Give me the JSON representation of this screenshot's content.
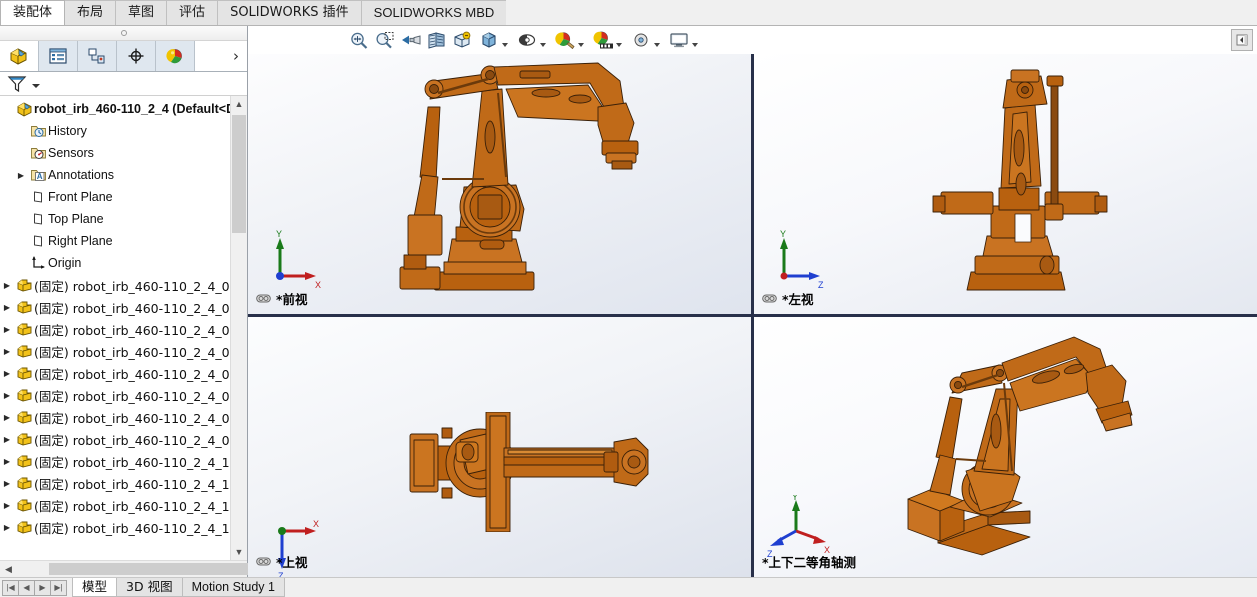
{
  "window": {
    "ribbon_tabs": [
      {
        "label": "装配体",
        "active": true,
        "cjk": true
      },
      {
        "label": "布局",
        "active": false,
        "cjk": true
      },
      {
        "label": "草图",
        "active": false,
        "cjk": true
      },
      {
        "label": "评估",
        "active": false,
        "cjk": true
      },
      {
        "label": "SOLIDWORKS 插件",
        "active": false,
        "cjk": true
      },
      {
        "label": "SOLIDWORKS MBD",
        "active": false,
        "cjk": false
      }
    ],
    "collapse_button_icon": "collapse-panel-icon"
  },
  "feature_manager": {
    "tabs": [
      {
        "name": "feature-manager-design-tree-tab",
        "icon": "assembly-tree-icon",
        "active": true
      },
      {
        "name": "property-manager-tab",
        "icon": "property-manager-icon",
        "active": false
      },
      {
        "name": "configuration-manager-tab",
        "icon": "configuration-manager-icon",
        "active": false
      },
      {
        "name": "dimxpert-manager-tab",
        "icon": "dimxpert-icon",
        "active": false
      },
      {
        "name": "display-manager-tab",
        "icon": "display-manager-icon",
        "active": false
      }
    ],
    "overflow_chevron": "›",
    "filter": {
      "icon": "filter-funnel-icon",
      "placeholder": ""
    },
    "tree": [
      {
        "label": "robot_irb_460-110_2_4  (Default<D",
        "icon": "assembly-icon",
        "indent": 0,
        "expander": "",
        "root": true,
        "cjk": false
      },
      {
        "label": "History",
        "icon": "history-folder-icon",
        "indent": 1,
        "expander": "",
        "root": false,
        "cjk": false
      },
      {
        "label": "Sensors",
        "icon": "sensors-folder-icon",
        "indent": 1,
        "expander": "",
        "root": false,
        "cjk": false
      },
      {
        "label": "Annotations",
        "icon": "annotations-folder-icon",
        "indent": 1,
        "expander": "▶",
        "root": false,
        "cjk": false
      },
      {
        "label": "Front Plane",
        "icon": "plane-icon",
        "indent": 1,
        "expander": "",
        "root": false,
        "cjk": false
      },
      {
        "label": "Top Plane",
        "icon": "plane-icon",
        "indent": 1,
        "expander": "",
        "root": false,
        "cjk": false
      },
      {
        "label": "Right Plane",
        "icon": "plane-icon",
        "indent": 1,
        "expander": "",
        "root": false,
        "cjk": false
      },
      {
        "label": "Origin",
        "icon": "origin-icon",
        "indent": 1,
        "expander": "",
        "root": false,
        "cjk": false
      },
      {
        "label": "(固定) robot_irb_460-110_2_4_0",
        "icon": "part-icon",
        "indent": 0,
        "expander": "▶",
        "root": false,
        "cjk": true
      },
      {
        "label": "(固定) robot_irb_460-110_2_4_0",
        "icon": "part-icon",
        "indent": 0,
        "expander": "▶",
        "root": false,
        "cjk": true
      },
      {
        "label": "(固定) robot_irb_460-110_2_4_0",
        "icon": "part-icon",
        "indent": 0,
        "expander": "▶",
        "root": false,
        "cjk": true
      },
      {
        "label": "(固定) robot_irb_460-110_2_4_0",
        "icon": "part-icon",
        "indent": 0,
        "expander": "▶",
        "root": false,
        "cjk": true
      },
      {
        "label": "(固定) robot_irb_460-110_2_4_0",
        "icon": "part-icon",
        "indent": 0,
        "expander": "▶",
        "root": false,
        "cjk": true
      },
      {
        "label": "(固定) robot_irb_460-110_2_4_0",
        "icon": "part-icon",
        "indent": 0,
        "expander": "▶",
        "root": false,
        "cjk": true
      },
      {
        "label": "(固定) robot_irb_460-110_2_4_0",
        "icon": "part-icon",
        "indent": 0,
        "expander": "▶",
        "root": false,
        "cjk": true
      },
      {
        "label": "(固定) robot_irb_460-110_2_4_0",
        "icon": "part-icon",
        "indent": 0,
        "expander": "▶",
        "root": false,
        "cjk": true
      },
      {
        "label": "(固定) robot_irb_460-110_2_4_1",
        "icon": "part-icon",
        "indent": 0,
        "expander": "▶",
        "root": false,
        "cjk": true
      },
      {
        "label": "(固定) robot_irb_460-110_2_4_1",
        "icon": "part-icon",
        "indent": 0,
        "expander": "▶",
        "root": false,
        "cjk": true
      },
      {
        "label": "(固定) robot_irb_460-110_2_4_1",
        "icon": "part-icon",
        "indent": 0,
        "expander": "▶",
        "root": false,
        "cjk": true
      },
      {
        "label": "(固定) robot_irb_460-110_2_4_1",
        "icon": "part-icon",
        "indent": 0,
        "expander": "▶",
        "root": false,
        "cjk": true
      }
    ]
  },
  "view_toolbar": [
    {
      "name": "zoom-to-fit-button",
      "icon": "zoom-to-fit-icon",
      "caret": false
    },
    {
      "name": "zoom-to-area-button",
      "icon": "zoom-to-area-icon",
      "caret": false
    },
    {
      "name": "previous-view-button",
      "icon": "previous-view-icon",
      "caret": false
    },
    {
      "name": "section-view-button",
      "icon": "section-view-icon",
      "caret": false
    },
    {
      "name": "view-orientation-button",
      "icon": "view-orientation-icon",
      "caret": false
    },
    {
      "name": "display-style-button",
      "icon": "display-style-icon",
      "caret": true
    },
    {
      "name": "hide-show-items-button",
      "icon": "hide-show-items-icon",
      "caret": true
    },
    {
      "name": "edit-appearance-button",
      "icon": "edit-appearance-icon",
      "caret": true
    },
    {
      "name": "apply-scene-button",
      "icon": "apply-scene-icon",
      "caret": true
    },
    {
      "name": "view-settings-button",
      "icon": "view-settings-icon",
      "caret": true
    },
    {
      "name": "display-pane-button",
      "icon": "display-pane-icon",
      "caret": true
    }
  ],
  "viewports": [
    {
      "name": "viewport-front",
      "label": "*前视",
      "link_icon": "view-link-icon",
      "triad": "front"
    },
    {
      "name": "viewport-left",
      "label": "*左视",
      "link_icon": "view-link-icon",
      "triad": "left"
    },
    {
      "name": "viewport-top",
      "label": "*上视",
      "link_icon": "view-link-icon",
      "triad": "top"
    },
    {
      "name": "viewport-trimetric",
      "label": "*上下二等角轴测",
      "link_icon": "view-link-icon",
      "triad": "iso"
    }
  ],
  "axis_labels": {
    "x": "X",
    "y": "Y",
    "z": "Z"
  },
  "model": {
    "body_color": "#c06a18",
    "body_color_dark": "#8a4a10",
    "body_color_light": "#d88a34",
    "edge_color": "#3a2008"
  },
  "status_bar": {
    "nav_buttons": [
      "|◀",
      "◀",
      "▶",
      "▶|"
    ],
    "tabs": [
      {
        "label": "模型",
        "active": true,
        "cjk": true
      },
      {
        "label": "3D 视图",
        "active": false,
        "cjk": true
      },
      {
        "label": "Motion Study 1",
        "active": false,
        "cjk": false
      }
    ]
  }
}
